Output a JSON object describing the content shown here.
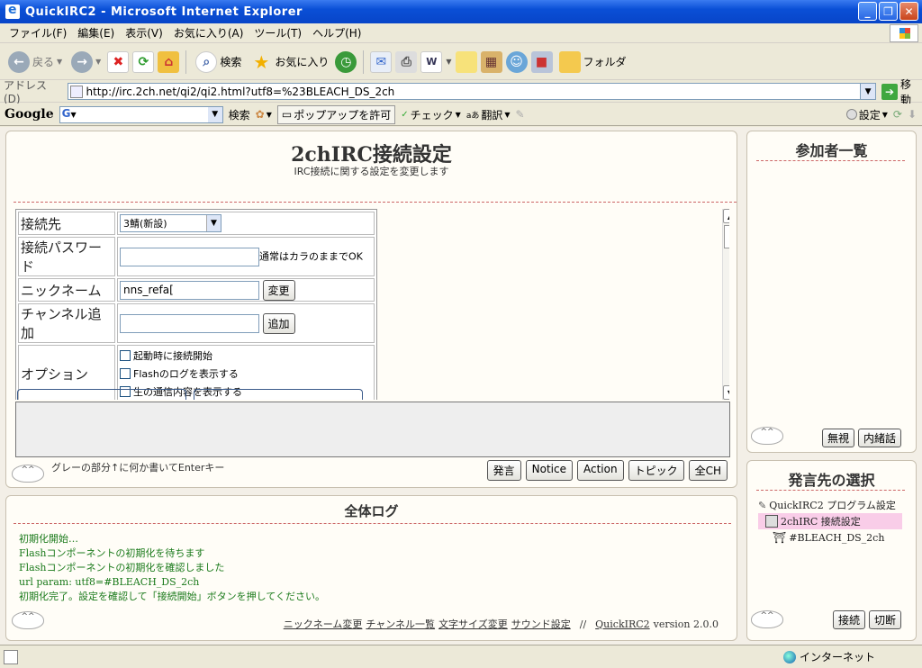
{
  "window": {
    "title": "QuickIRC2 - Microsoft Internet Explorer"
  },
  "menu": [
    "ファイル(F)",
    "編集(E)",
    "表示(V)",
    "お気に入り(A)",
    "ツール(T)",
    "ヘルプ(H)"
  ],
  "toolbar": {
    "back": "戻る",
    "search": "検索",
    "favorites": "お気に入り",
    "folder": "フォルダ"
  },
  "address": {
    "label": "アドレス(D)",
    "url": "http://irc.2ch.net/qi2/qi2.html?utf8=%23BLEACH_DS_2ch",
    "go": "移動"
  },
  "google": {
    "logo": "Google",
    "search_box": "G",
    "search_btn": "検索",
    "popup": "ポップアップを許可",
    "check": "チェック",
    "translate": "翻訳",
    "settings": "設定"
  },
  "main": {
    "title": "2chIRC接続設定",
    "subtitle": "IRC接続に関する設定を変更します",
    "rows": {
      "server_label": "接続先",
      "server_value": "3鯖(新設)",
      "password_label": "接続パスワード",
      "password_note": "通常はカラのままでOK",
      "nick_label": "ニックネーム",
      "nick_value": "nns_refa[",
      "nick_button": "変更",
      "channel_label": "チャンネル追加",
      "channel_button": "追加",
      "options_label": "オプション",
      "options": [
        "起動時に接続開始",
        "Flashのログを表示する",
        "生の通信内容を表示する"
      ]
    },
    "hint": "グレーの部分↑に何か書いてEnterキー",
    "actions": [
      "発言",
      "Notice",
      "Action",
      "トピック",
      "全CH"
    ]
  },
  "log": {
    "title": "全体ログ",
    "lines": [
      "初期化開始…",
      "Flashコンポーネントの初期化を待ちます",
      "Flashコンポーネントの初期化を確認しました",
      "url param: utf8=#BLEACH_DS_2ch",
      "初期化完了。設定を確認して「接続開始」ボタンを押してください。"
    ],
    "footer": {
      "links": [
        "ニックネーム変更",
        "チャンネル一覧",
        "文字サイズ変更",
        "サウンド設定"
      ],
      "separator": "//",
      "app_link": "QuickIRC2",
      "version": "version 2.0.0"
    }
  },
  "users": {
    "title": "参加者一覧",
    "buttons": [
      "無視",
      "内緒話"
    ]
  },
  "target": {
    "title": "発言先の選択",
    "items": [
      "QuickIRC2 プログラム設定",
      "2chIRC 接続設定",
      "#BLEACH_DS_2ch"
    ],
    "buttons": [
      "接続",
      "切断"
    ]
  },
  "status": {
    "zone": "インターネット"
  },
  "colors": {
    "log_text": "#1b7a1b",
    "selected_item": "#f9cde8",
    "dash": "#cc6666"
  }
}
